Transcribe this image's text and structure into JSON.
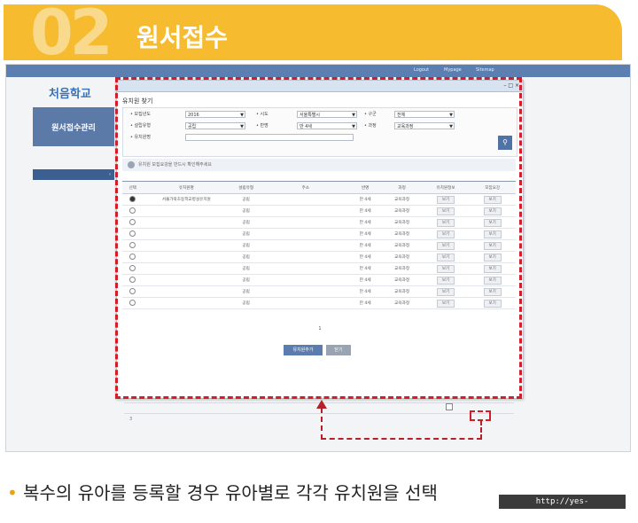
{
  "header": {
    "number": "02",
    "title": "원서접수"
  },
  "browser": {
    "topnav": [
      "",
      "Logout",
      "Mypage",
      "Sitemap"
    ],
    "logo": "처음학교",
    "sidebar": {
      "title": "원서접수관리",
      "items": [
        {
          "label": "",
          "active": false
        },
        {
          "label": "",
          "active": true
        },
        {
          "label": "",
          "active": false
        }
      ]
    }
  },
  "modal": {
    "url": "",
    "window_controls": "– □ ×",
    "title": "유치원 찾기",
    "filters": {
      "row1": [
        {
          "label": "모집년도",
          "value": "2016"
        },
        {
          "label": "시도",
          "value": "서울특별시"
        },
        {
          "label": "구군",
          "value": "전체"
        }
      ],
      "row2": [
        {
          "label": "설립유형",
          "value": "공립"
        },
        {
          "label": "반명",
          "value": "만 4세"
        },
        {
          "label": "과정",
          "value": "교육과정"
        }
      ],
      "row3": [
        {
          "label": "유치원명",
          "value": ""
        }
      ],
      "search_icon": "magnifier-icon"
    },
    "notice": "유치원 모집요강을 반드시 확인해주세요",
    "table": {
      "headers": [
        "선택",
        "유치원명",
        "설립유형",
        "주소",
        "반명",
        "과정",
        "유치원정보",
        "모집요강"
      ],
      "rows": [
        {
          "name": "서울가락초등학교병설유치원",
          "type": "공립",
          "address": "",
          "class": "만 4세",
          "course": "교육과정",
          "info": "보기",
          "guide": "보기",
          "selected": true
        },
        {
          "name": "",
          "type": "공립",
          "address": "",
          "class": "만 4세",
          "course": "교육과정",
          "info": "보기",
          "guide": "보기",
          "selected": false
        },
        {
          "name": "",
          "type": "공립",
          "address": "",
          "class": "만 4세",
          "course": "교육과정",
          "info": "보기",
          "guide": "보기",
          "selected": false
        },
        {
          "name": "",
          "type": "공립",
          "address": "",
          "class": "만 4세",
          "course": "교육과정",
          "info": "보기",
          "guide": "보기",
          "selected": false
        },
        {
          "name": "",
          "type": "공립",
          "address": "",
          "class": "만 4세",
          "course": "교육과정",
          "info": "보기",
          "guide": "보기",
          "selected": false
        },
        {
          "name": "",
          "type": "공립",
          "address": "",
          "class": "만 4세",
          "course": "교육과정",
          "info": "보기",
          "guide": "보기",
          "selected": false
        },
        {
          "name": "",
          "type": "공립",
          "address": "",
          "class": "만 4세",
          "course": "교육과정",
          "info": "보기",
          "guide": "보기",
          "selected": false
        },
        {
          "name": "",
          "type": "공립",
          "address": "",
          "class": "만 4세",
          "course": "교육과정",
          "info": "보기",
          "guide": "보기",
          "selected": false
        },
        {
          "name": "",
          "type": "공립",
          "address": "",
          "class": "만 4세",
          "course": "교육과정",
          "info": "보기",
          "guide": "보기",
          "selected": false
        },
        {
          "name": "",
          "type": "공립",
          "address": "",
          "class": "만 4세",
          "course": "교육과정",
          "info": "보기",
          "guide": "보기",
          "selected": false
        }
      ]
    },
    "pager": "1",
    "add_button": "유치원추가",
    "close_button": "닫기"
  },
  "bg_rows": [
    {
      "num": "",
      "text": ""
    },
    {
      "num": "3",
      "text": ""
    }
  ],
  "caption": {
    "bullet": "•",
    "text": "복수의 유아를 등록할 경우 유아별로 각각 유치원을 선택"
  },
  "watermark": "http://yes-today.tistory.com"
}
